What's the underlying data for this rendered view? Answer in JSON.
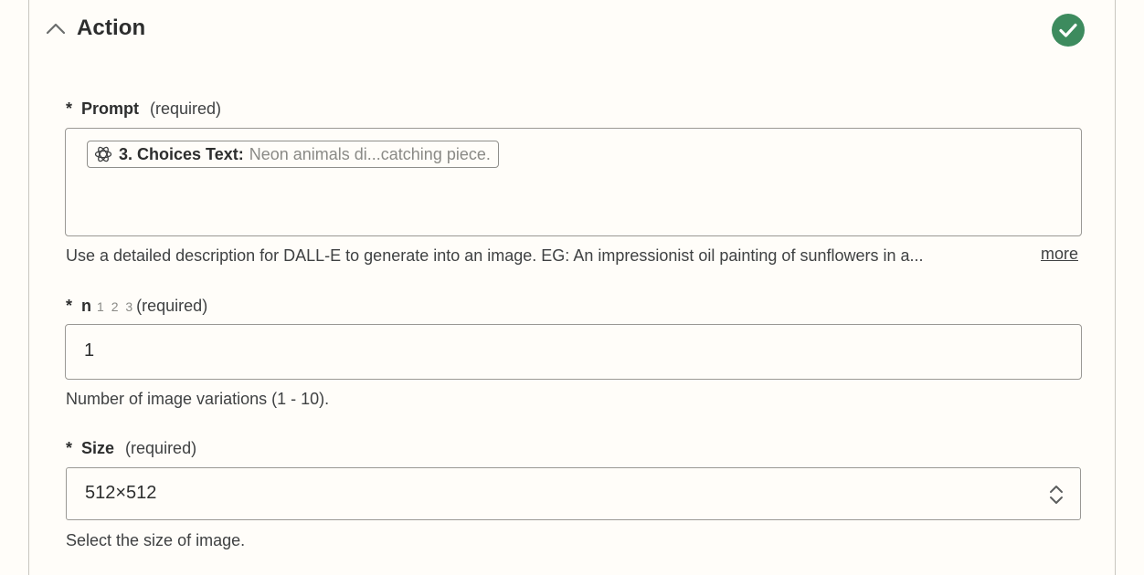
{
  "section": {
    "title": "Action",
    "status": "complete",
    "status_color": "#3d8b5e"
  },
  "fields": {
    "prompt": {
      "required_marker": "*",
      "label": "Prompt",
      "required_text": "(required)",
      "pill": {
        "icon": "openai-icon",
        "key": "3. Choices Text:",
        "value": "Neon animals di...catching piece."
      },
      "help": "Use a detailed description for DALL-E to generate into an image. EG: An impressionist oil painting of sunflowers in a...",
      "more_label": "more"
    },
    "n": {
      "required_marker": "*",
      "label": "n",
      "type_hint": "1 2 3",
      "required_text": "(required)",
      "value": "1",
      "help": "Number of image variations (1 - 10)."
    },
    "size": {
      "required_marker": "*",
      "label": "Size",
      "required_text": "(required)",
      "value": "512×512",
      "help": "Select the size of image."
    }
  }
}
